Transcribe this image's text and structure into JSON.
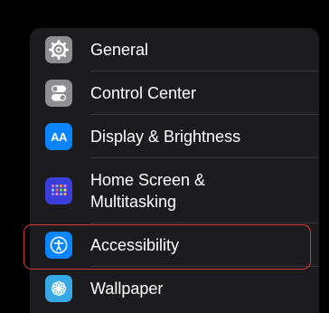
{
  "settings": {
    "items": [
      {
        "label": "General",
        "icon": "gear-icon",
        "icon_color": "#8e8e93"
      },
      {
        "label": "Control Center",
        "icon": "toggles-icon",
        "icon_color": "#8e8e93"
      },
      {
        "label": "Display & Brightness",
        "icon": "text-size-icon",
        "icon_glyph": "AA",
        "icon_color": "#0a84ff"
      },
      {
        "label_line1": "Home Screen &",
        "label_line2": "Multitasking",
        "icon": "home-grid-icon",
        "icon_color": "#3a3fd9"
      },
      {
        "label": "Accessibility",
        "icon": "accessibility-icon",
        "icon_color": "#0a84ff",
        "highlighted": true
      },
      {
        "label": "Wallpaper",
        "icon": "flower-icon",
        "icon_color": "#36a8e6"
      }
    ]
  },
  "colors": {
    "background": "#000000",
    "group_background": "#1c1c1e",
    "separator": "#38383a",
    "highlight_border": "#d23a3a"
  }
}
